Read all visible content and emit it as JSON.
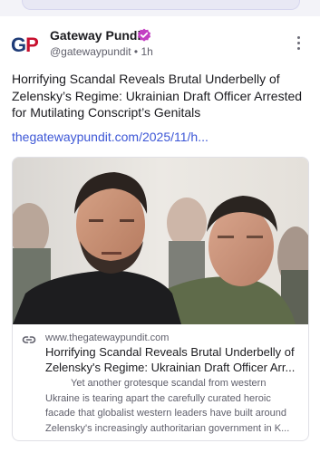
{
  "post": {
    "author": {
      "logo_letters": {
        "g": "G",
        "p": "P"
      },
      "name": "Gateway Pundit",
      "handle": "@gatewaypundit",
      "separator": "•",
      "time": "1h",
      "verified_icon": "verified-check-icon",
      "verified_color": "#c33ec3"
    },
    "menu_icon": "more-vertical-icon",
    "headline": "Horrifying Scandal Reveals Brutal Underbelly of Zelensky’s Regime: Ukrainian Draft Officer Arrested for Mutilating Conscript’s Genitals",
    "link_text": "thegatewaypundit.com/2025/11/h...",
    "link_color": "#3d57d6"
  },
  "card": {
    "image_icon": "news-photo",
    "link_icon": "link-icon",
    "domain": "www.thegatewaypundit.com",
    "title_line1": "Horrifying Scandal Reveals Brutal Underbelly of",
    "title_line2": "Zelensky's Regime: Ukrainian Draft Officer Arr...",
    "desc_line1": "Yet another grotesque scandal from western",
    "desc_line2": "Ukraine is tearing apart the carefully curated heroic",
    "desc_line3": "facade that globalist western leaders have built around",
    "desc_line4": "Zelensky's increasingly authoritarian government in K..."
  }
}
